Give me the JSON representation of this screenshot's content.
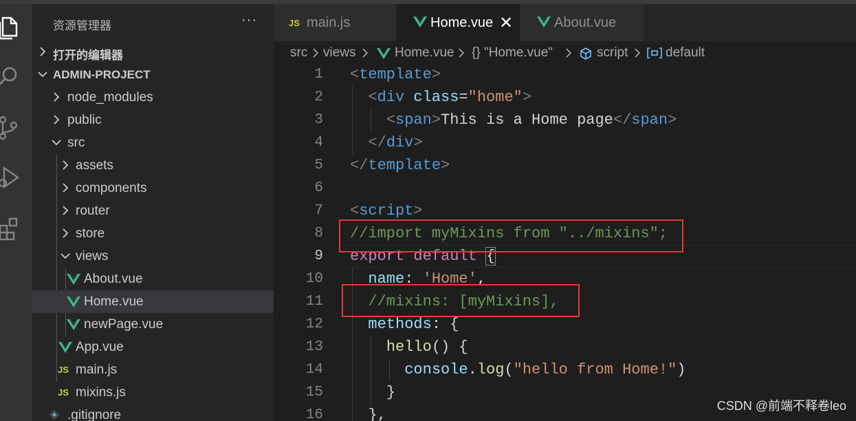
{
  "activity_bar": {
    "icons": [
      "explorer-icon",
      "search-icon",
      "source-control-icon",
      "run-debug-icon",
      "extensions-icon"
    ]
  },
  "sidebar": {
    "title": "资源管理器",
    "more": "···",
    "open_editors": "打开的编辑器",
    "project": "ADMIN-PROJECT",
    "tree": [
      {
        "label": "node_modules",
        "type": "folder"
      },
      {
        "label": "public",
        "type": "folder"
      },
      {
        "label": "src",
        "type": "folder-open"
      },
      {
        "label": "assets",
        "type": "folder"
      },
      {
        "label": "components",
        "type": "folder"
      },
      {
        "label": "router",
        "type": "folder"
      },
      {
        "label": "store",
        "type": "folder"
      },
      {
        "label": "views",
        "type": "folder-open"
      },
      {
        "label": "About.vue",
        "type": "vue"
      },
      {
        "label": "Home.vue",
        "type": "vue",
        "selected": true
      },
      {
        "label": "newPage.vue",
        "type": "vue"
      },
      {
        "label": "App.vue",
        "type": "vue"
      },
      {
        "label": "main.js",
        "type": "js"
      },
      {
        "label": "mixins.js",
        "type": "js"
      },
      {
        "label": ".gitignore",
        "type": "git"
      }
    ],
    "js_badge": "JS"
  },
  "tabs": [
    {
      "label": "main.js",
      "icon": "js-icon"
    },
    {
      "label": "Home.vue",
      "icon": "vue-icon",
      "active": true,
      "close": "✕"
    },
    {
      "label": "About.vue",
      "icon": "vue-icon"
    }
  ],
  "breadcrumb": [
    "src",
    "views",
    "Home.vue",
    "{} \"Home.vue\"",
    "script",
    "default"
  ],
  "editor": {
    "line_numbers": [
      "1",
      "2",
      "3",
      "4",
      "5",
      "6",
      "7",
      "8",
      "9",
      "10",
      "11",
      "12",
      "13",
      "14",
      "15",
      "16"
    ],
    "current_line": "9",
    "code": {
      "l1_tag": "template",
      "l2_tag": "div",
      "l2_attr": "class",
      "l2_val": "\"home\"",
      "l3_tag": "span",
      "l3_text": "This is a Home page",
      "l4_tag": "div",
      "l5_tag": "template",
      "l7_tag": "script",
      "l8_comment": "//import myMixins from \"../mixins\";",
      "l9_kw": "export default",
      "l10_prop": "name",
      "l10_val": "'Home'",
      "l11_comment": "//mixins: [myMixins],",
      "l12_prop": "methods",
      "l13_fn": "hello",
      "l14_obj": "console",
      "l14_fn": "log",
      "l14_str": "\"hello from Home!\"",
      "l15_text": "}",
      "l16_text": "},"
    }
  },
  "watermark": "CSDN @前端不释卷leo",
  "colors": {
    "highlight_box": "#e53935",
    "vue_green": "#42b883",
    "js_yellow": "#cbcb41"
  }
}
